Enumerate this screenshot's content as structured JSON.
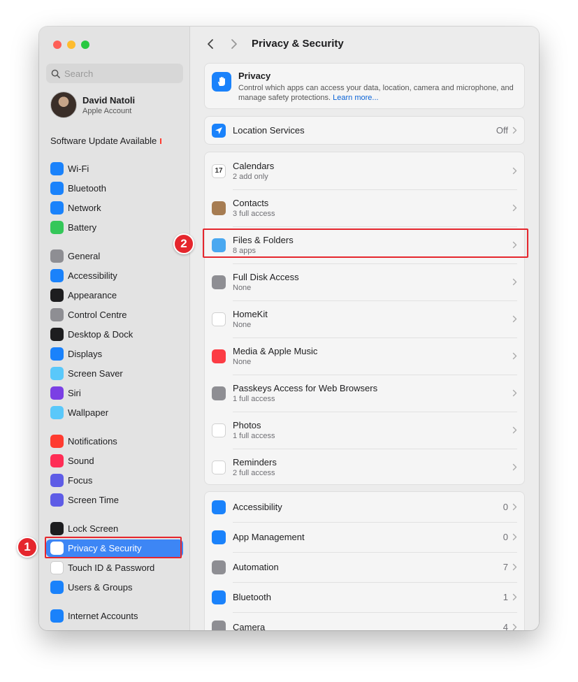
{
  "window": {
    "title": "Privacy & Security"
  },
  "sidebar": {
    "search_placeholder": "Search",
    "account": {
      "name": "David Natoli",
      "subtitle": "Apple Account"
    },
    "update_label": "Software Update Available",
    "items": [
      {
        "label": "Wi-Fi",
        "icon": "wifi-icon",
        "color": "#1a82fb"
      },
      {
        "label": "Bluetooth",
        "icon": "bluetooth-icon",
        "color": "#1a82fb"
      },
      {
        "label": "Network",
        "icon": "globe-icon",
        "color": "#1a82fb"
      },
      {
        "label": "Battery",
        "icon": "battery-icon",
        "color": "#34c759"
      },
      {
        "label": "General",
        "icon": "gear-icon",
        "color": "#8e8e93"
      },
      {
        "label": "Accessibility",
        "icon": "accessibility-icon",
        "color": "#1a82fb"
      },
      {
        "label": "Appearance",
        "icon": "appearance-icon",
        "color": "#1d1d1f"
      },
      {
        "label": "Control Centre",
        "icon": "control-centre-icon",
        "color": "#8e8e93"
      },
      {
        "label": "Desktop & Dock",
        "icon": "dock-icon",
        "color": "#1d1d1f"
      },
      {
        "label": "Displays",
        "icon": "sun-icon",
        "color": "#1a82fb"
      },
      {
        "label": "Screen Saver",
        "icon": "screen-saver-icon",
        "color": "#5ac8fa"
      },
      {
        "label": "Siri",
        "icon": "siri-icon",
        "color": "#7b3fe4"
      },
      {
        "label": "Wallpaper",
        "icon": "flower-icon",
        "color": "#5ac8fa"
      },
      {
        "label": "Notifications",
        "icon": "bell-icon",
        "color": "#ff3b30"
      },
      {
        "label": "Sound",
        "icon": "speaker-icon",
        "color": "#ff2d55"
      },
      {
        "label": "Focus",
        "icon": "moon-icon",
        "color": "#5e5ce6"
      },
      {
        "label": "Screen Time",
        "icon": "hourglass-icon",
        "color": "#5e5ce6"
      },
      {
        "label": "Lock Screen",
        "icon": "lock-icon",
        "color": "#1d1d1f"
      },
      {
        "label": "Privacy & Security",
        "icon": "hand-icon",
        "color": "#1a82fb",
        "selected": true
      },
      {
        "label": "Touch ID & Password",
        "icon": "fingerprint-icon",
        "color": "#ffffff"
      },
      {
        "label": "Users & Groups",
        "icon": "users-icon",
        "color": "#1a82fb"
      },
      {
        "label": "Internet Accounts",
        "icon": "at-icon",
        "color": "#1a82fb"
      }
    ]
  },
  "main": {
    "title": "Privacy & Security",
    "privacy": {
      "title": "Privacy",
      "description": "Control which apps can access your data, location, camera and microphone, and manage safety protections.",
      "link": "Learn more..."
    },
    "location": {
      "label": "Location Services",
      "value": "Off"
    },
    "permissions": [
      {
        "label": "Calendars",
        "sub": "2 add only",
        "icon": "calendar-icon",
        "color": "#ffffff",
        "glyph": "17"
      },
      {
        "label": "Contacts",
        "sub": "3 full access",
        "icon": "contacts-icon",
        "color": "#a67c52",
        "glyph": ""
      },
      {
        "label": "Files & Folders",
        "sub": "8 apps",
        "icon": "folder-icon",
        "color": "#4aa8f0",
        "glyph": ""
      },
      {
        "label": "Full Disk Access",
        "sub": "None",
        "icon": "disk-icon",
        "color": "#8e8e93",
        "glyph": ""
      },
      {
        "label": "HomeKit",
        "sub": "None",
        "icon": "home-icon",
        "color": "#ffffff",
        "glyph": ""
      },
      {
        "label": "Media & Apple Music",
        "sub": "None",
        "icon": "music-icon",
        "color": "#fc3c44",
        "glyph": ""
      },
      {
        "label": "Passkeys Access for Web Browsers",
        "sub": "1 full access",
        "icon": "passkey-icon",
        "color": "#8e8e93",
        "glyph": ""
      },
      {
        "label": "Photos",
        "sub": "1 full access",
        "icon": "photos-icon",
        "color": "#ffffff",
        "glyph": ""
      },
      {
        "label": "Reminders",
        "sub": "2 full access",
        "icon": "reminders-icon",
        "color": "#ffffff",
        "glyph": ""
      }
    ],
    "more": [
      {
        "label": "Accessibility",
        "value": "0",
        "icon": "accessibility-icon",
        "color": "#1a82fb"
      },
      {
        "label": "App Management",
        "value": "0",
        "icon": "app-store-icon",
        "color": "#1a82fb"
      },
      {
        "label": "Automation",
        "value": "7",
        "icon": "gears-icon",
        "color": "#8e8e93"
      },
      {
        "label": "Bluetooth",
        "value": "1",
        "icon": "bluetooth-icon",
        "color": "#1a82fb"
      },
      {
        "label": "Camera",
        "value": "4",
        "icon": "camera-icon",
        "color": "#8e8e93"
      }
    ]
  },
  "callouts": [
    "1",
    "2"
  ],
  "colors": {
    "accent": "#3d86f5",
    "callout": "#e5262d"
  }
}
